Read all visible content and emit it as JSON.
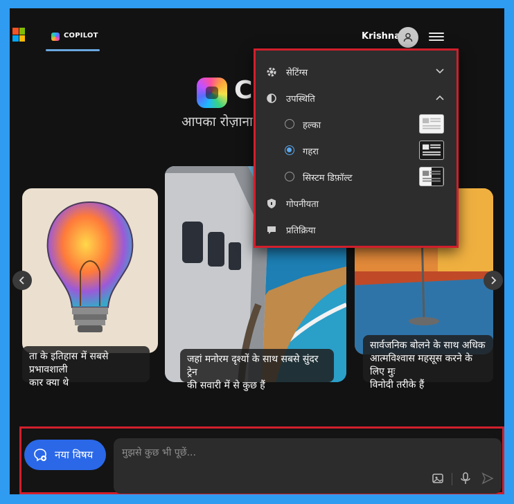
{
  "header": {
    "tab_label": "COPILOT",
    "user_name": "Krishna"
  },
  "hero": {
    "title": "Co",
    "subtitle": "आपका रोज़ाना"
  },
  "cards": [
    {
      "caption_line1": "ता के इतिहास में सबसे प्रभावशाली",
      "caption_line2": "कार क्या थे"
    },
    {
      "caption_line1": "जहां मनोरम दृश्यों के साथ सबसे सुंदर ट्रेन",
      "caption_line2": "की सवारी में से कुछ हैं"
    },
    {
      "caption_line1": "सार्वजनिक बोलने के साथ अधिक",
      "caption_line2": "आत्मविश्वास महसूस करने के लिए मुः",
      "caption_line3": "विनोदी तरीके हैं"
    }
  ],
  "menu": {
    "settings": "सेटिंग्स",
    "appearance": "उपस्थिति",
    "theme_options": [
      {
        "label": "हल्का",
        "selected": false
      },
      {
        "label": "गहरा",
        "selected": true
      },
      {
        "label": "सिस्टम डिफ़ॉल्ट",
        "selected": false
      }
    ],
    "privacy": "गोपनीयता",
    "feedback": "प्रतिक्रिया"
  },
  "bottom": {
    "new_topic": "नया विषय",
    "placeholder": "मुझसे कुछ भी पूछें..."
  },
  "colors": {
    "accent": "#2a68e8",
    "highlight_border": "#d21f2c",
    "radio_selected": "#5aa9f0",
    "page_border": "#2f9cf1"
  }
}
